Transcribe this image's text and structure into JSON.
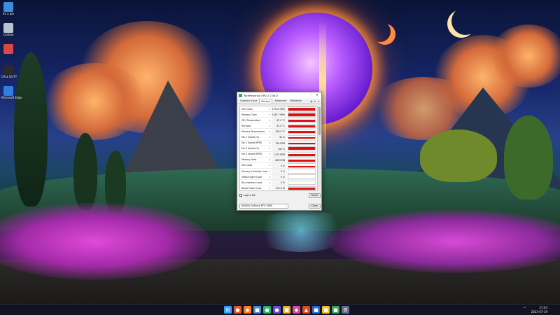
{
  "desktop": {
    "icons": [
      {
        "label": "Ex a già",
        "icon": "monitor-icon",
        "color": "#3c8de0"
      },
      {
        "label": "Cestino",
        "icon": "recycle-bin-icon",
        "color": "#b9c4cf"
      },
      {
        "label": "",
        "icon": "app-icon",
        "color": "#d94848"
      },
      {
        "label": "CALL DUTY",
        "icon": "game-icon",
        "color": "#2a2a2a"
      },
      {
        "label": "Microsoft Edge",
        "icon": "windows-icon",
        "color": "#2f7fe0"
      }
    ]
  },
  "gpuz": {
    "title": "TechPowerUp GPU-Z 2.58.0",
    "tabs": [
      {
        "label": "Graphics Card",
        "active": false
      },
      {
        "label": "Sensors",
        "active": true
      },
      {
        "label": "Advanced",
        "active": false
      },
      {
        "label": "Validation",
        "active": false
      }
    ],
    "sensors": [
      {
        "name": "GPU Clock",
        "value": "1770.0 MHz",
        "level": 0.85
      },
      {
        "name": "Memory Clock",
        "value": "1187.7 MHz",
        "level": 0.9
      },
      {
        "name": "GPU Temperature",
        "value": "67.0 °C",
        "level": 0.6
      },
      {
        "name": "Hot Spot",
        "value": "67.0 °C",
        "level": 0.62
      },
      {
        "name": "Memory Temperature",
        "value": "106.0 °C",
        "level": 0.75
      },
      {
        "name": "Fan 1 Speed (%)",
        "value": "40 %",
        "level": 0.45
      },
      {
        "name": "Fan 1 Speed (RPM)",
        "value": "796 RPM",
        "level": 0.5
      },
      {
        "name": "Fan 2 Speed (%)",
        "value": "100 %",
        "level": 0.95
      },
      {
        "name": "Fan 2 Speed (RPM)",
        "value": "1270 RPM",
        "level": 0.6
      },
      {
        "name": "Memory Used",
        "value": "8039 MB",
        "level": 0.7
      },
      {
        "name": "GPU Load",
        "value": "0 %",
        "level": 0.35
      },
      {
        "name": "Memory Controller Load",
        "value": "0 %",
        "level": 0.0
      },
      {
        "name": "Video Engine Load",
        "value": "0 %",
        "level": 0.0
      },
      {
        "name": "Bus Interface Load",
        "value": "0 %",
        "level": 0.0
      },
      {
        "name": "Board Power Draw",
        "value": "321.0 W",
        "level": 0.6
      }
    ],
    "log_label": "Log to file",
    "reset_label": "Reset",
    "gpu_select": "NVIDIA GeForce RTX 3080",
    "close_label": "Close"
  },
  "taskbar": {
    "icons": [
      {
        "name": "start-icon",
        "glyph": "⊞",
        "color": "#3aa0ff"
      },
      {
        "name": "game-launcher-icon",
        "glyph": "●",
        "color": "#e05a2a"
      },
      {
        "name": "browser-icon",
        "glyph": "◉",
        "color": "#ff7a1a"
      },
      {
        "name": "folder-icon",
        "glyph": "■",
        "color": "#4a8ad8"
      },
      {
        "name": "chat-icon",
        "glyph": "●",
        "color": "#28b86a"
      },
      {
        "name": "media-icon",
        "glyph": "●",
        "color": "#6a4ad8"
      },
      {
        "name": "files-icon",
        "glyph": "■",
        "color": "#e8b02a"
      },
      {
        "name": "photos-icon",
        "glyph": "◆",
        "color": "#d84a9a"
      },
      {
        "name": "brave-icon",
        "glyph": "▲",
        "color": "#e04a1a"
      },
      {
        "name": "store-icon",
        "glyph": "■",
        "color": "#2a6ad8"
      },
      {
        "name": "explorer-icon",
        "glyph": "■",
        "color": "#f0c020"
      },
      {
        "name": "gpuz-icon",
        "glyph": "■",
        "color": "#3aa655"
      },
      {
        "name": "settings-icon",
        "glyph": "⚙",
        "color": "#6a6a8a"
      }
    ],
    "time": "21:03",
    "date": "2023-07-19"
  }
}
